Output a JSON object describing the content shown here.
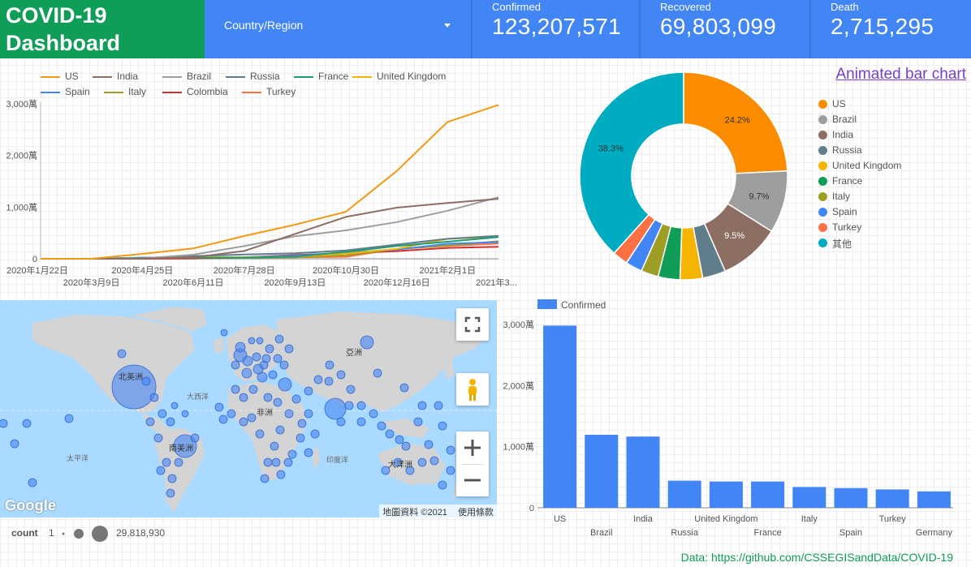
{
  "header": {
    "title_line1": "COVID-19",
    "title_line2": "Dashboard",
    "filter_label": "Country/Region",
    "kpis": [
      {
        "label": "Confirmed",
        "value": "123,207,571"
      },
      {
        "label": "Recovered",
        "value": "69,803,099"
      },
      {
        "label": "Death",
        "value": "2,715,295"
      }
    ],
    "colors": {
      "title_bg": "#0f9d58",
      "bar_bg": "#4285f4"
    }
  },
  "line_chart": {
    "legend": [
      "US",
      "India",
      "Brazil",
      "Russia",
      "France",
      "United Kingdom",
      "Spain",
      "Italy",
      "Colombia",
      "Turkey"
    ],
    "y_ticks": [
      "3,000萬",
      "2,000萬",
      "1,000萬",
      "0"
    ],
    "x_ticks_row1": [
      "2020年1月22日",
      "2020年4月25日",
      "2020年7月28日",
      "2020年10月30日",
      "2021年2月1日"
    ],
    "x_ticks_row2": [
      "2020年3月9日",
      "2020年6月11日",
      "2020年9月13日",
      "2020年12月16日",
      "2021年3..."
    ]
  },
  "donut_chart": {
    "link_text": "Animated bar chart",
    "slice_labels": {
      "US": "24.2%",
      "Brazil": "9.7%",
      "India": "9.5%",
      "其他": "38.3%"
    }
  },
  "map": {
    "google_label": "Google",
    "attribution": "地圖資料 ©2021",
    "terms": "使用條款",
    "continents": [
      "北美洲",
      "南美洲",
      "非洲",
      "亞洲",
      "大洋洲"
    ],
    "oceans": [
      "大西洋",
      "太平洋",
      "印度洋"
    ],
    "buttons": {
      "fullscreen": "fullscreen-icon",
      "pegman": "pegman-icon",
      "zoom_in": "+",
      "zoom_out": "−"
    },
    "size_legend": {
      "title": "count",
      "min": "1",
      "max": "29,818,930"
    }
  },
  "bar_chart_legend": "Confirmed",
  "footer": {
    "data_source": "Data: https://github.com/CSSEGISandData/COVID-19"
  },
  "chart_data": [
    {
      "type": "line",
      "title": "",
      "xlabel": "",
      "ylabel": "",
      "x": [
        "2020-01-22",
        "2020-03-09",
        "2020-04-25",
        "2020-06-11",
        "2020-07-28",
        "2020-09-13",
        "2020-10-30",
        "2020-12-16",
        "2021-02-01",
        "2021-03-21"
      ],
      "ylim": [
        0,
        30000000
      ],
      "y_tick_values": [
        0,
        10000000,
        20000000,
        30000000
      ],
      "series": [
        {
          "name": "US",
          "color": "#f29a14",
          "values": [
            0,
            0,
            950000,
            2000000,
            4400000,
            6600000,
            9100000,
            17000000,
            26500000,
            29800000
          ]
        },
        {
          "name": "India",
          "color": "#8d6e63",
          "values": [
            0,
            0,
            20000,
            290000,
            1500000,
            4800000,
            8100000,
            9900000,
            10800000,
            11600000
          ]
        },
        {
          "name": "Brazil",
          "color": "#9e9e9e",
          "values": [
            0,
            0,
            60000,
            780000,
            2450000,
            4350000,
            5500000,
            7100000,
            9300000,
            11900000
          ]
        },
        {
          "name": "Russia",
          "color": "#607d8b",
          "values": [
            0,
            0,
            75000,
            500000,
            830000,
            1060000,
            1600000,
            2750000,
            3860000,
            4450000
          ]
        },
        {
          "name": "France",
          "color": "#1b9e77",
          "values": [
            0,
            0,
            160000,
            190000,
            220000,
            400000,
            1330000,
            2460000,
            3300000,
            4200000
          ]
        },
        {
          "name": "United Kingdom",
          "color": "#f4b400",
          "values": [
            0,
            0,
            150000,
            290000,
            300000,
            380000,
            1000000,
            1900000,
            3850000,
            4300000
          ]
        },
        {
          "name": "Spain",
          "color": "#4285f4",
          "values": [
            0,
            0,
            220000,
            240000,
            290000,
            600000,
            1200000,
            1770000,
            2900000,
            3220000
          ]
        },
        {
          "name": "Italy",
          "color": "#9e9d24",
          "values": [
            0,
            0,
            195000,
            236000,
            246000,
            288000,
            680000,
            1900000,
            2560000,
            3400000
          ]
        },
        {
          "name": "Colombia",
          "color": "#d32f2f",
          "values": [
            0,
            0,
            5000,
            45000,
            260000,
            720000,
            1060000,
            1480000,
            2110000,
            2330000
          ]
        },
        {
          "name": "Turkey",
          "color": "#ff7043",
          "values": [
            0,
            0,
            107000,
            173000,
            228000,
            292000,
            380000,
            1900000,
            2470000,
            2950000
          ]
        }
      ]
    },
    {
      "type": "pie",
      "categories": [
        "US",
        "Brazil",
        "India",
        "Russia",
        "United Kingdom",
        "France",
        "Italy",
        "Spain",
        "Turkey",
        "其他"
      ],
      "values": [
        24.2,
        9.7,
        9.5,
        3.6,
        3.5,
        3.4,
        2.7,
        2.6,
        2.4,
        38.3
      ],
      "colors": [
        "#fb8c00",
        "#9e9e9e",
        "#8d6e63",
        "#607d8b",
        "#f4b400",
        "#0f9d58",
        "#9e9d24",
        "#4285f4",
        "#ff7043",
        "#00acc1"
      ],
      "legend_position": "right"
    },
    {
      "type": "bar",
      "categories": [
        "US",
        "Brazil",
        "India",
        "Russia",
        "United Kingdom",
        "France",
        "Italy",
        "Spain",
        "Turkey",
        "Germany"
      ],
      "series": [
        {
          "name": "Confirmed",
          "color": "#4285f4",
          "values": [
            29818930,
            11950000,
            11650000,
            4430000,
            4300000,
            4300000,
            3400000,
            3220000,
            3000000,
            2680000
          ]
        }
      ],
      "ylim": [
        0,
        30000000
      ],
      "y_ticks": [
        "3,000萬",
        "2,000萬",
        "1,000萬",
        "0"
      ],
      "y_tick_values": [
        30000000,
        20000000,
        10000000,
        0
      ],
      "legend_position": "top-left"
    }
  ]
}
